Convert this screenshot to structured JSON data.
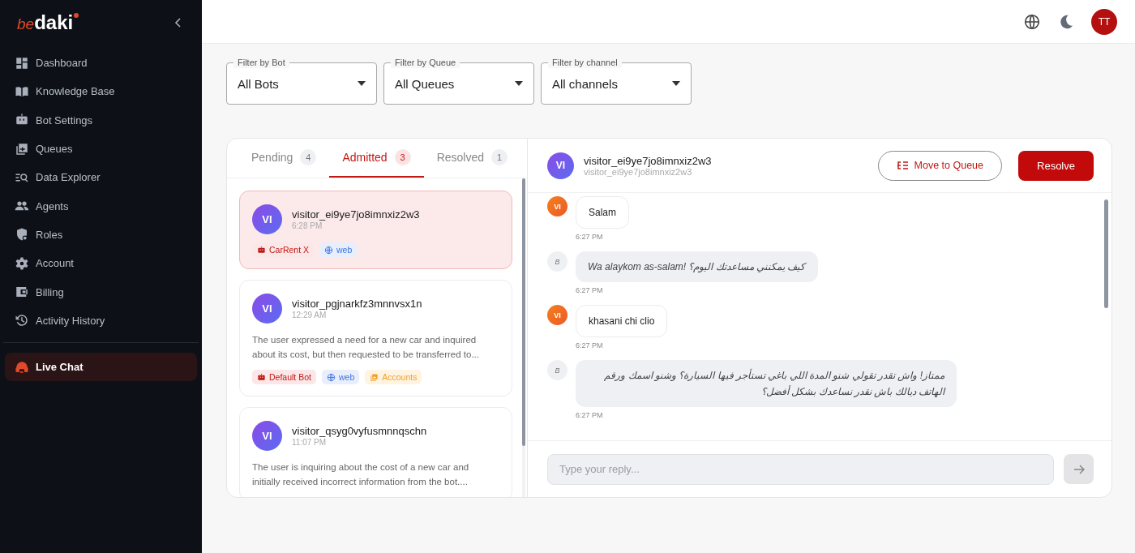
{
  "logo": {
    "prefix": "be",
    "name": "daki"
  },
  "sidebar": {
    "items": [
      {
        "label": "Dashboard",
        "selected": false
      },
      {
        "label": "Knowledge Base",
        "selected": false
      },
      {
        "label": "Bot Settings",
        "selected": false
      },
      {
        "label": "Queues",
        "selected": false
      },
      {
        "label": "Data Explorer",
        "selected": false
      },
      {
        "label": "Agents",
        "selected": false
      },
      {
        "label": "Roles",
        "selected": false
      },
      {
        "label": "Account",
        "selected": false
      },
      {
        "label": "Billing",
        "selected": false
      },
      {
        "label": "Activity History",
        "selected": false
      }
    ],
    "bottom_items": [
      {
        "label": "Live Chat",
        "selected": true
      }
    ]
  },
  "topbar": {
    "user_initials": "TT"
  },
  "filters": [
    {
      "label": "Filter by Bot",
      "value": "All Bots"
    },
    {
      "label": "Filter by Queue",
      "value": "All Queues"
    },
    {
      "label": "Filter by channel",
      "value": "All channels"
    }
  ],
  "tabs": [
    {
      "label": "Pending",
      "count": "4",
      "selected": false
    },
    {
      "label": "Admitted",
      "count": "3",
      "selected": true
    },
    {
      "label": "Resolved",
      "count": "1",
      "selected": false
    }
  ],
  "conversations": [
    {
      "initials": "VI",
      "name": "visitor_ei9ye7jo8imnxiz2w3",
      "time": "6:28 PM",
      "selected": true,
      "tags": [
        {
          "kind": "bot",
          "label": "CarRent X"
        },
        {
          "kind": "channel",
          "label": "web"
        }
      ]
    },
    {
      "initials": "VI",
      "name": "visitor_pgjnarkfz3mnnvsx1n",
      "time": "12:29 AM",
      "selected": false,
      "summary": "The user expressed a need for a new car and inquired about its cost, but then requested to be transferred to...",
      "tags": [
        {
          "kind": "bot",
          "label": "Default Bot"
        },
        {
          "kind": "channel",
          "label": "web"
        },
        {
          "kind": "queue",
          "label": "Accounts"
        }
      ]
    },
    {
      "initials": "VI",
      "name": "visitor_qsyg0vyfusmnnqschn",
      "time": "11:07 PM",
      "selected": false,
      "summary": "The user is inquiring about the cost of a new car and initially received incorrect information from the bot...."
    }
  ],
  "chat": {
    "initials": "VI",
    "name": "visitor_ei9ye7jo8imnxiz2w3",
    "subtitle": "visitor_ei9ye7jo8imnxiz2w3",
    "move_button": "Move to Queue",
    "resolve_button": "Resolve",
    "messages": [
      {
        "kind": "visitor",
        "initials": "VI",
        "text": "Salam",
        "time": "6:27 PM"
      },
      {
        "kind": "bot",
        "initials": "B",
        "text": "Wa alaykom as-salam! كيف يمكنني مساعدتك اليوم؟",
        "time": "6:27 PM"
      },
      {
        "kind": "visitor",
        "initials": "VI",
        "text": "khasani chi clio",
        "time": "6:27 PM"
      },
      {
        "kind": "bot",
        "initials": "B",
        "text": "ممتاز! واش تقدر تقولي شنو المدة اللي باغي تستأجر فيها السيارة؟ وشنو اسمك ورقم الهاتف ديالك باش نقدر نساعدك بشكل أفضل؟",
        "time": "6:27 PM"
      }
    ],
    "reply_placeholder": "Type your reply..."
  }
}
